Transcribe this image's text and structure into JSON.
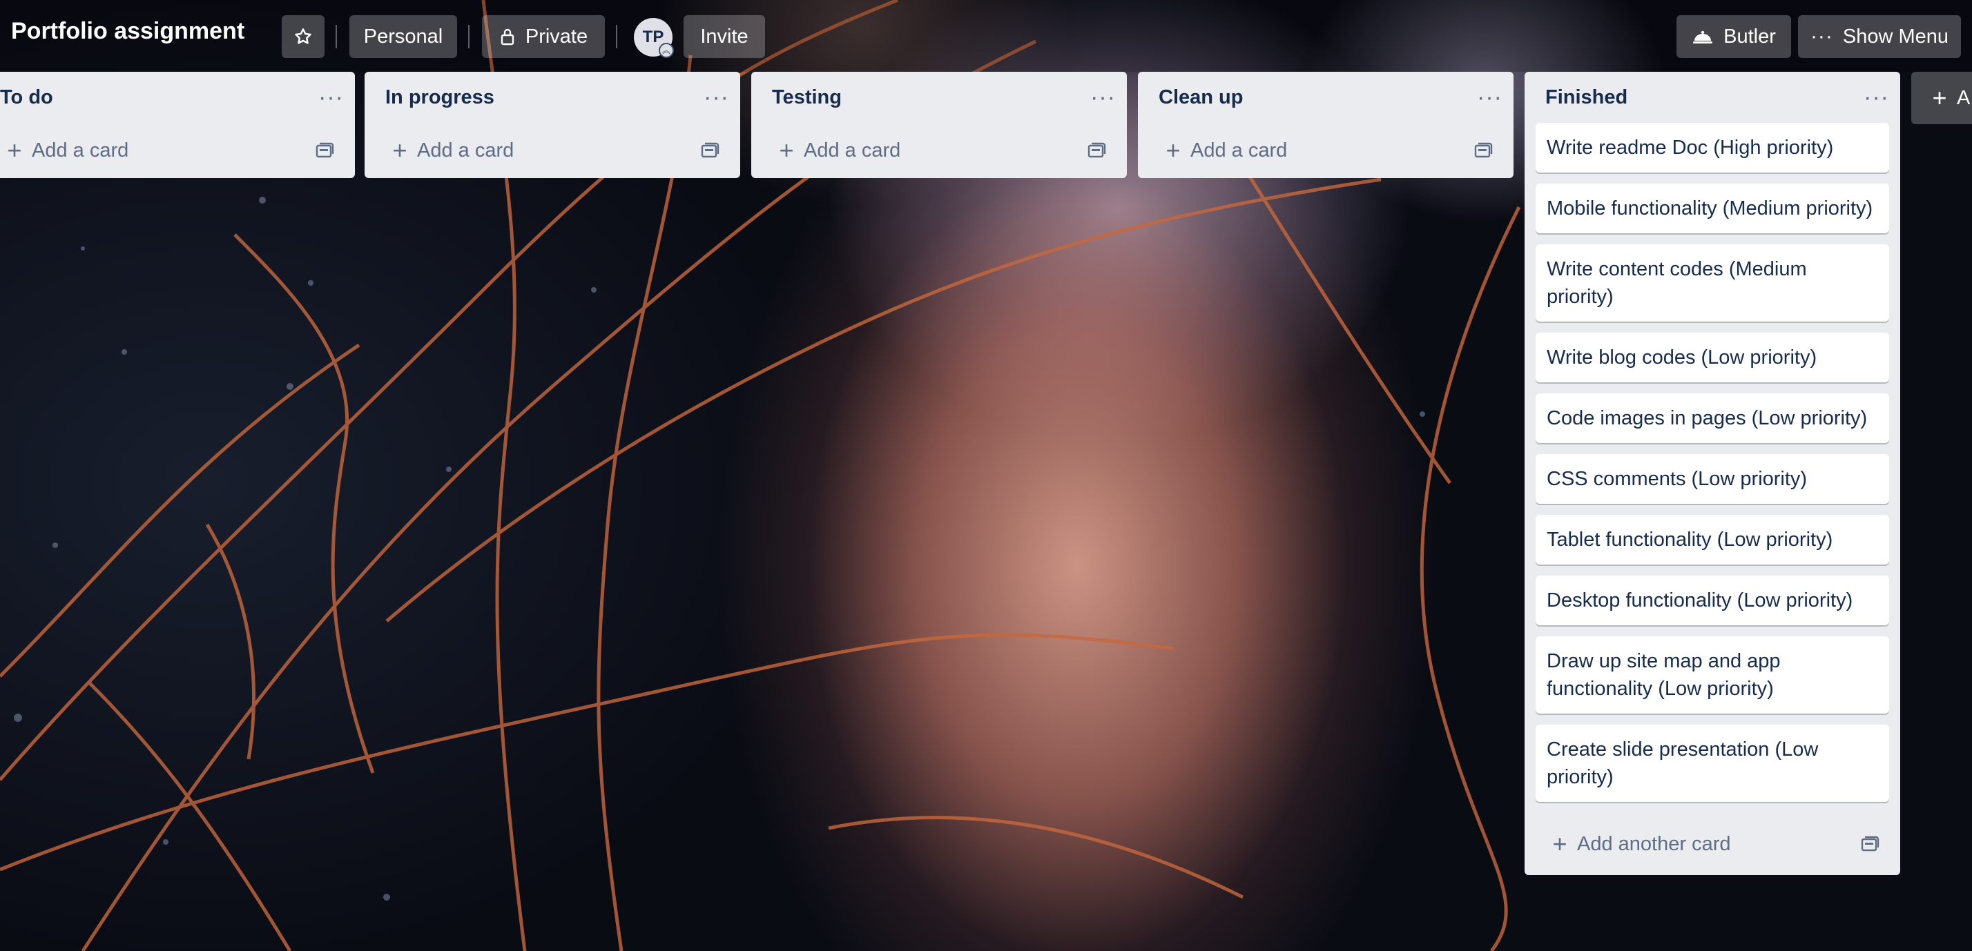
{
  "board": {
    "title": "Portfolio assignment",
    "team_label": "Personal",
    "visibility_label": "Private",
    "avatar_initials": "TP",
    "invite_label": "Invite",
    "butler_label": "Butler",
    "show_menu_label": "Show Menu",
    "add_list_label": "A"
  },
  "icons": {
    "star": "star-icon",
    "lock": "lock-icon",
    "butler": "butler-icon",
    "menu": "more-icon",
    "plus": "plus-icon",
    "template": "card-template-icon"
  },
  "lists": [
    {
      "title": "To do",
      "add_label": "Add a card",
      "cards": []
    },
    {
      "title": "In progress",
      "add_label": "Add a card",
      "cards": []
    },
    {
      "title": "Testing",
      "add_label": "Add a card",
      "cards": []
    },
    {
      "title": "Clean up",
      "add_label": "Add a card",
      "cards": []
    },
    {
      "title": "Finished",
      "add_label": "Add another card",
      "cards": [
        "Write readme Doc (High priority)",
        "Mobile functionality (Medium priority)",
        "Write content codes (Medium priority)",
        "Write blog codes (Low priority)",
        "Code images in pages (Low priority)",
        "CSS comments (Low priority)",
        "Tablet functionality (Low priority)",
        "Desktop functionality (Low priority)",
        "Draw up site map and app functionality (Low priority)",
        "Create slide presentation (Low priority)"
      ]
    }
  ]
}
